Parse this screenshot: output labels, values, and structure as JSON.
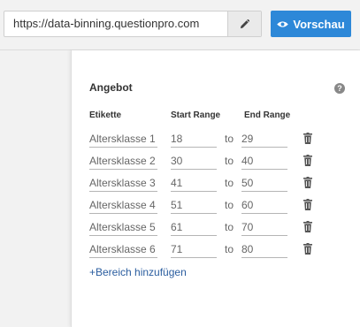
{
  "url_bar": {
    "value": "https://data-binning.questionpro.com"
  },
  "toolbar": {
    "preview_label": "Vorschau"
  },
  "panel": {
    "title": "Angebot",
    "columns": {
      "label": "Etikette",
      "start": "Start Range",
      "end": "End Range"
    },
    "connector": "to",
    "rows": [
      {
        "label": "Altersklasse 1",
        "start": "18",
        "end": "29"
      },
      {
        "label": "Altersklasse 2",
        "start": "30",
        "end": "40"
      },
      {
        "label": "Altersklasse 3",
        "start": "41",
        "end": "50"
      },
      {
        "label": "Altersklasse 4",
        "start": "51",
        "end": "60"
      },
      {
        "label": "Altersklasse 5",
        "start": "61",
        "end": "70"
      },
      {
        "label": "Altersklasse 6",
        "start": "71",
        "end": "80"
      }
    ],
    "add_label": "+Bereich hinzufügen"
  },
  "colors": {
    "accent": "#2d88d8",
    "link": "#2a5d9f"
  },
  "icons": {
    "edit": "pencil-icon",
    "preview": "eye-icon",
    "help": "question-circle-icon",
    "delete": "trash-icon"
  }
}
